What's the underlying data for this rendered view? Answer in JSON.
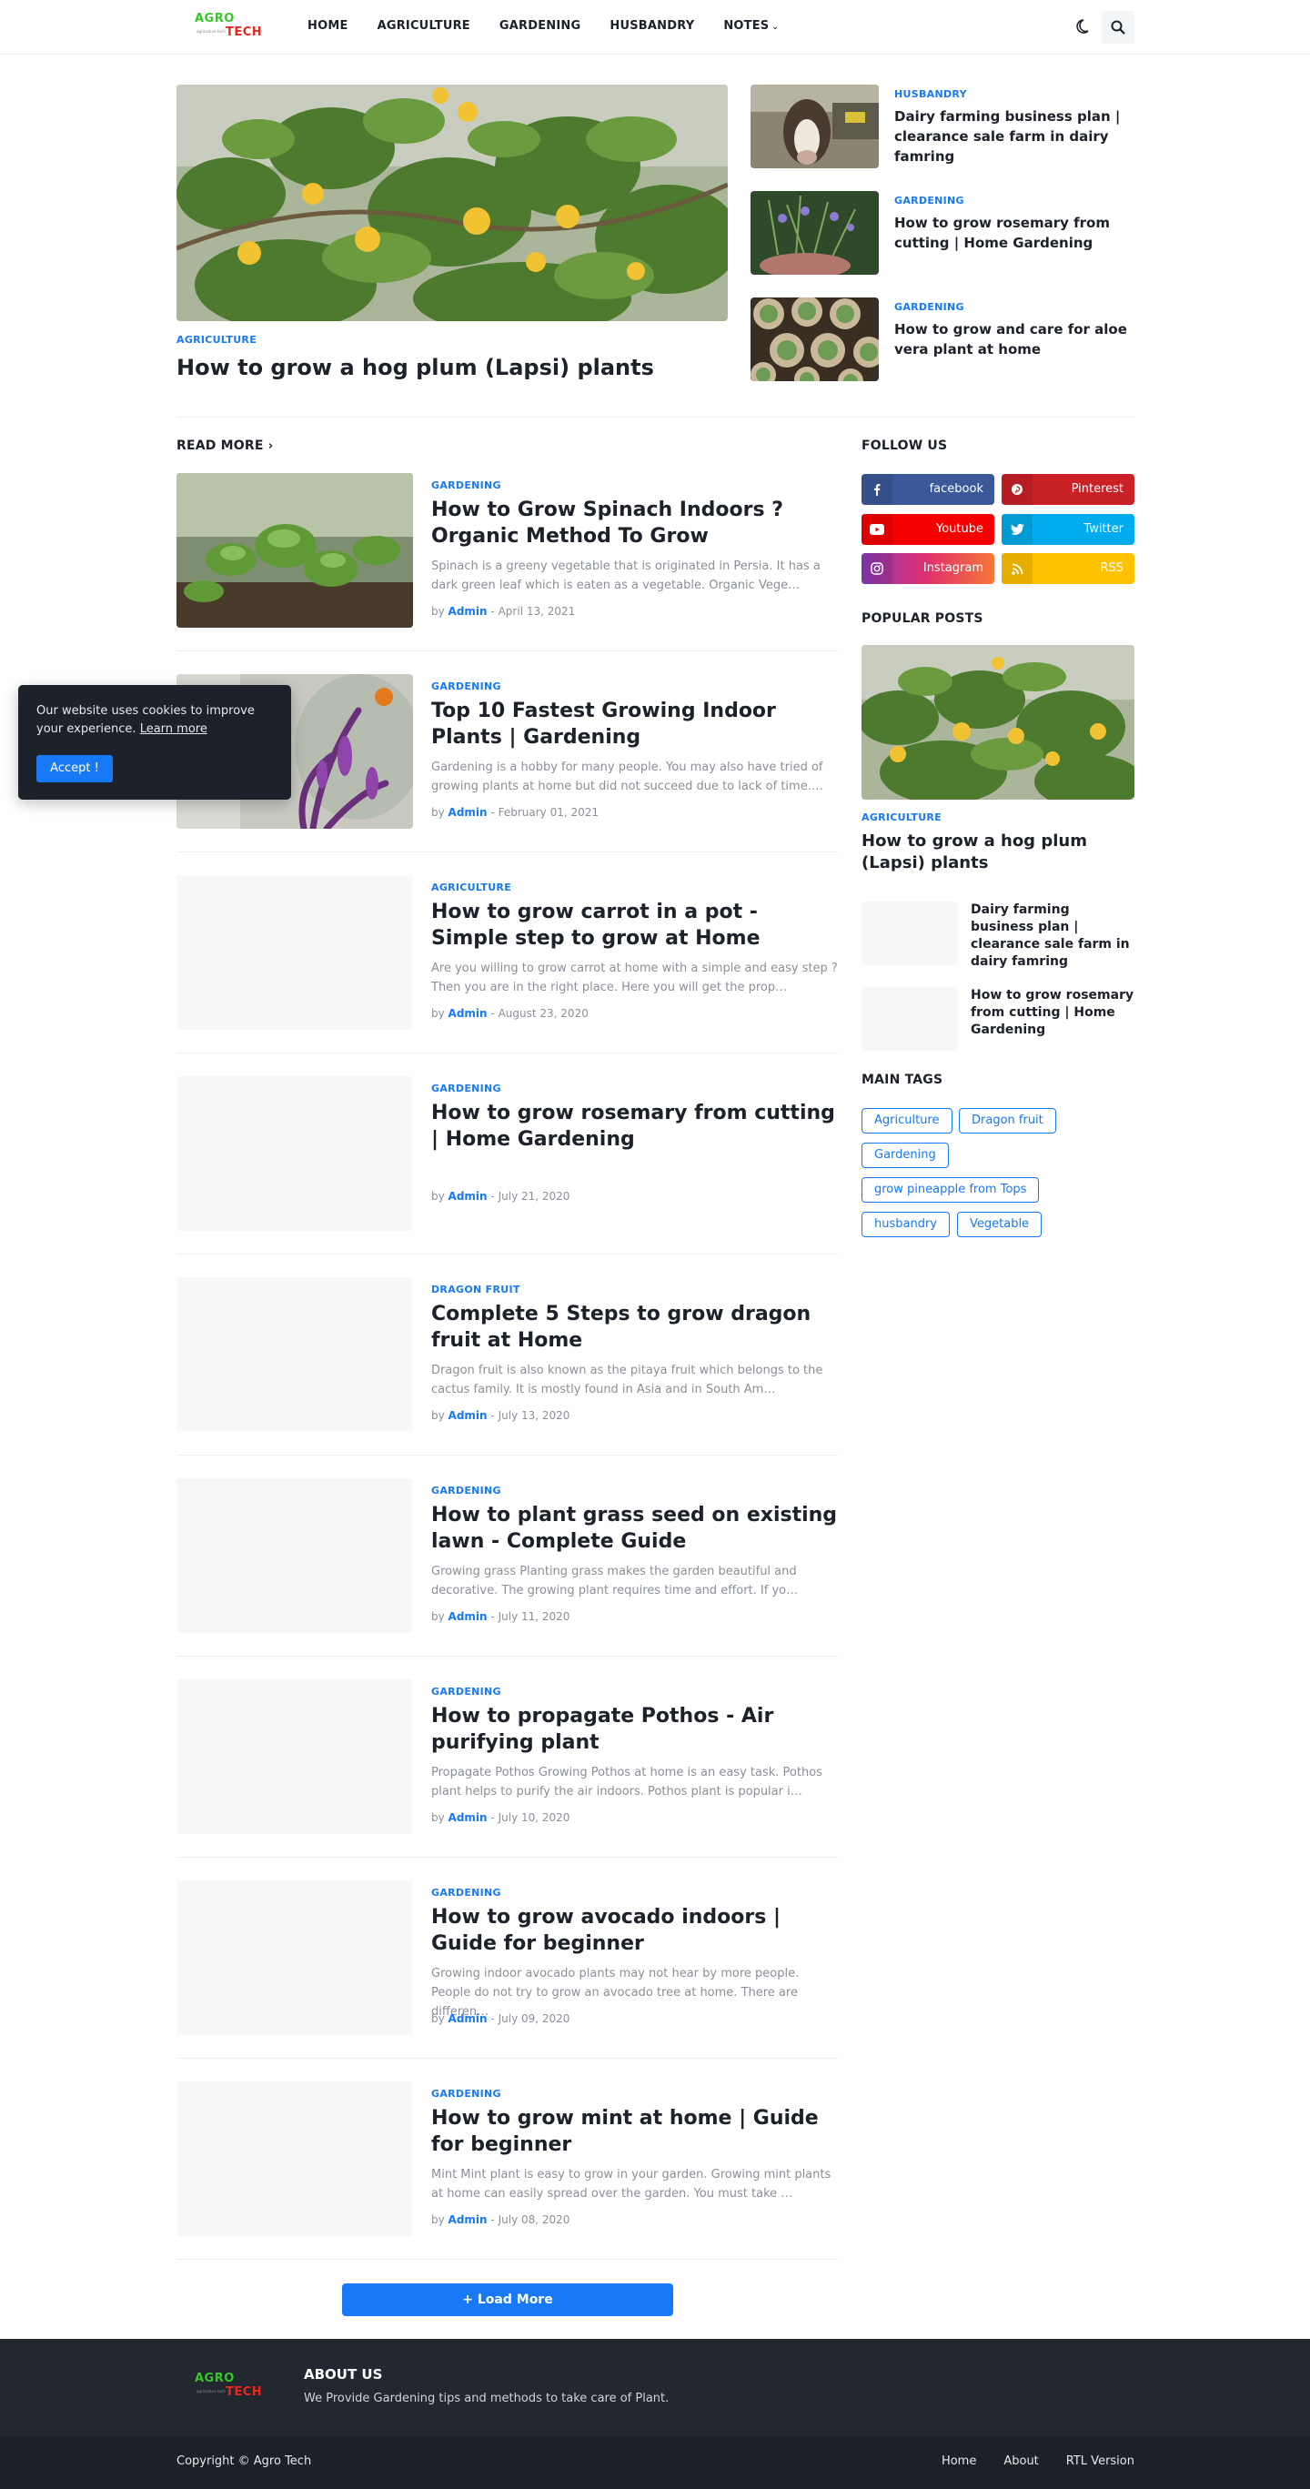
{
  "brand": {
    "line1": "AGRO",
    "line2": "TECH",
    "tagline": "agriculture tech"
  },
  "nav": {
    "home": "HOME",
    "agriculture": "AGRICULTURE",
    "gardening": "GARDENING",
    "husbandry": "HUSBANDRY",
    "notes": "NOTES"
  },
  "icons": {
    "theme": "moon-icon",
    "search": "search-icon"
  },
  "featured": {
    "main": {
      "category": "AGRICULTURE",
      "title": "How to grow a hog plum (Lapsi) plants"
    },
    "side": [
      {
        "category": "HUSBANDRY",
        "title": "Dairy farming business plan | clearance sale farm in dairy famring"
      },
      {
        "category": "GARDENING",
        "title": "How to grow rosemary from cutting | Home Gardening"
      },
      {
        "category": "GARDENING",
        "title": "How to grow and care for aloe vera plant at home"
      }
    ]
  },
  "read_more": "READ MORE",
  "posts": [
    {
      "category": "GARDENING",
      "title": "How to Grow Spinach Indoors ? Organic Method To Grow",
      "snippet": "Spinach is a greeny vegetable that is originated in Persia. It has a dark green leaf which is eaten as a vegetable. Organic Vege…",
      "author": "Admin",
      "date": "April 13, 2021"
    },
    {
      "category": "GARDENING",
      "title": "Top 10 Fastest Growing Indoor Plants | Gardening",
      "snippet": "Gardening is a hobby for many people. You may also have tried of growing plants at home but did not succeed due to lack of time.…",
      "author": "Admin",
      "date": "February 01, 2021"
    },
    {
      "category": "AGRICULTURE",
      "title": "How to grow carrot in a pot - Simple step to grow at Home",
      "snippet": "Are you willing to grow carrot at home with a simple and easy step ? Then you are in the right place. Here you will get the prop…",
      "author": "Admin",
      "date": "August 23, 2020"
    },
    {
      "category": "GARDENING",
      "title": "How to grow rosemary from cutting | Home Gardening",
      "snippet": "",
      "author": "Admin",
      "date": "July 21, 2020"
    },
    {
      "category": "DRAGON FRUIT",
      "title": "Complete 5 Steps to grow dragon fruit at Home",
      "snippet": "Dragon fruit is also known as the pitaya fruit which belongs to the cactus family. It is mostly found in Asia and in South Am…",
      "author": "Admin",
      "date": "July 13, 2020"
    },
    {
      "category": "GARDENING",
      "title": "How to plant grass seed on existing lawn - Complete Guide",
      "snippet": "Growing grass Planting grass makes the garden beautiful and decorative. The growing plant requires time and effort. If yo…",
      "author": "Admin",
      "date": "July 11, 2020"
    },
    {
      "category": "GARDENING",
      "title": "How to propagate Pothos - Air purifying plant",
      "snippet": "Propagate Pothos Growing Pothos at home is an easy task. Pothos plant helps to purify the air indoors. Pothos plant is popular i…",
      "author": "Admin",
      "date": "July 10, 2020"
    },
    {
      "category": "GARDENING",
      "title": "How to grow avocado indoors | Guide for beginner",
      "snippet": "Growing indoor avocado plants may not hear by more people. People do not try to grow an avocado tree at home. There are differen…",
      "author": "Admin",
      "date": "July 09, 2020"
    },
    {
      "category": "GARDENING",
      "title": "How to grow mint at home | Guide for beginner",
      "snippet": "Mint  Mint plant is easy to grow in your garden. Growing mint plants at home can easily spread over the garden. You must take …",
      "author": "Admin",
      "date": "July 08, 2020"
    }
  ],
  "by_label": "by",
  "dash": "-",
  "load_more": "Load More",
  "sidebar": {
    "follow_title": "FOLLOW US",
    "social": [
      {
        "label": "facebook",
        "icon": "facebook-icon",
        "color": "#3b5999"
      },
      {
        "label": "Pinterest",
        "icon": "pinterest-icon",
        "color": "#ca2127"
      },
      {
        "label": "Youtube",
        "icon": "youtube-icon",
        "color": "#f50000"
      },
      {
        "label": "Twitter",
        "icon": "twitter-icon",
        "color": "#00acee"
      },
      {
        "label": "Instagram",
        "icon": "instagram-icon",
        "color": "#c13584"
      },
      {
        "label": "RSS",
        "icon": "rss-icon",
        "color": "#ffc200"
      }
    ],
    "popular_title": "POPULAR POSTS",
    "popular_main": {
      "category": "AGRICULTURE",
      "title": "How to grow a hog plum (Lapsi) plants"
    },
    "popular_items": [
      {
        "title": "Dairy farming business plan | clearance sale farm in dairy famring"
      },
      {
        "title": "How to grow rosemary from cutting | Home Gardening"
      }
    ],
    "tags_title": "MAIN TAGS",
    "tags": [
      "Agriculture",
      "Dragon fruit",
      "Gardening",
      "grow pineapple from Tops",
      "husbandry",
      "Vegetable"
    ]
  },
  "cookie": {
    "text": "Our website uses cookies to improve your experience.",
    "learn_more": "Learn more",
    "accept": "Accept !"
  },
  "footer": {
    "about_title": "ABOUT US",
    "about_text": "We Provide Gardening tips and methods to take care of Plant.",
    "copyright": "Copyright © Agro Tech",
    "links": [
      "Home",
      "About",
      "RTL Version"
    ]
  },
  "colors": {
    "accent": "#1779f5",
    "dark": "#1d2129",
    "footer": "#23272f"
  }
}
